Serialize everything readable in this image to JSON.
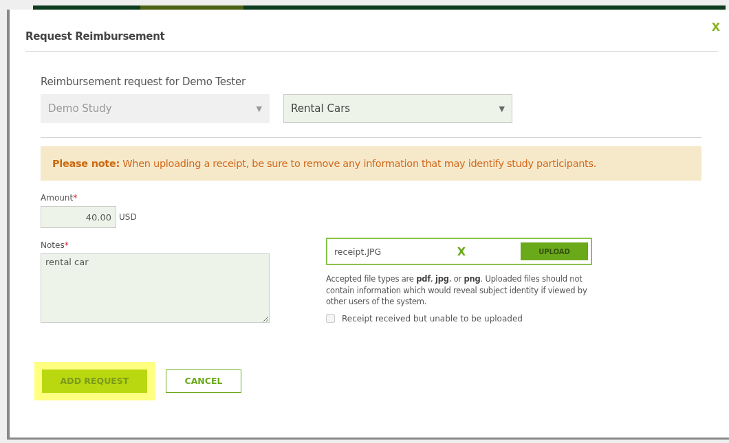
{
  "dialog": {
    "title": "Request Reimbursement",
    "close": "X"
  },
  "recipient_text": "Reimbursement request for Demo Tester",
  "selects": [
    {
      "value": "Demo Study",
      "disabled": true,
      "arrow": "▼"
    },
    {
      "value": "Rental Cars",
      "disabled": false,
      "arrow": "▼"
    }
  ],
  "notice": "**Please note:** When uploading a receipt, be sure to remove any information that may identify study participants.",
  "amount": {
    "label": "Amount",
    "required": "*",
    "value": "40.00",
    "currency": "USD"
  },
  "notes": {
    "label": "Notes",
    "required": "*",
    "value": "rental car"
  },
  "upload": {
    "filename": "receipt.JPG",
    "remove": "X",
    "button": "UPLOAD",
    "help": "Accepted file types are **pdf**, **jpg**, or **png**. Uploaded files should not contain information which would reveal subject identity if viewed by other users of the system.",
    "checkbox": {
      "label": "Receipt received but unable to be uploaded",
      "checked": false
    }
  },
  "buttons": [
    {
      "label": "ADD REQUEST",
      "kind": "primary",
      "highlighted": true
    },
    {
      "label": "CANCEL",
      "kind": "secondary",
      "highlighted": false
    }
  ]
}
